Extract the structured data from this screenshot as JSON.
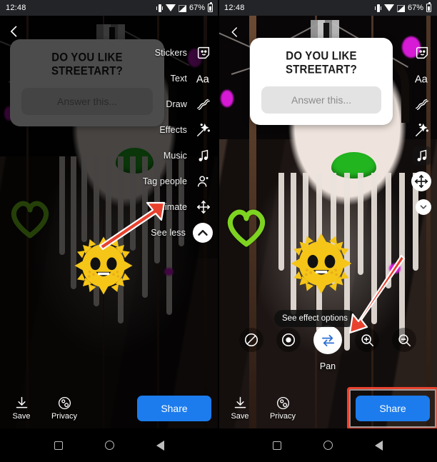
{
  "status_bar": {
    "time": "12:48",
    "battery_percent": "67%",
    "icons": [
      "vibrate-icon",
      "wifi-icon",
      "signal-icon",
      "battery-icon"
    ]
  },
  "question_sticker": {
    "title": "DO YOU LIKE STREETART?",
    "answer_placeholder": "Answer this..."
  },
  "left_panel": {
    "back_icon": "back-arrow-icon",
    "tool_rail": [
      {
        "label": "Stickers",
        "icon": "sticker-face-icon"
      },
      {
        "label": "Text",
        "icon": "text-aa-icon"
      },
      {
        "label": "Draw",
        "icon": "draw-squiggle-icon"
      },
      {
        "label": "Effects",
        "icon": "effects-sparkle-wand-icon"
      },
      {
        "label": "Music",
        "icon": "music-note-icon"
      },
      {
        "label": "Tag people",
        "icon": "tag-person-icon"
      },
      {
        "label": "Animate",
        "icon": "animate-move-arrows-icon"
      },
      {
        "label": "See less",
        "icon": "chevron-up-icon"
      }
    ],
    "bottom_actions": [
      {
        "label": "Save",
        "icon": "download-save-icon"
      },
      {
        "label": "Privacy",
        "icon": "privacy-gear-icon"
      }
    ],
    "share_label": "Share",
    "annotation": "red-arrow-pointing-to-animate"
  },
  "right_panel": {
    "back_icon": "back-chevron-icon",
    "tool_rail": [
      {
        "label": "Stickers",
        "icon": "sticker-face-icon"
      },
      {
        "label": "Text",
        "icon": "text-aa-icon"
      },
      {
        "label": "Draw",
        "icon": "draw-squiggle-icon"
      },
      {
        "label": "Effects",
        "icon": "effects-sparkle-wand-icon"
      },
      {
        "label": "Music",
        "icon": "music-note-icon"
      },
      {
        "label": "Animate",
        "icon": "animate-move-arrows-icon"
      },
      {
        "label": "See less",
        "icon": "chevron-down-icon"
      }
    ],
    "effect_tooltip": "See effect options",
    "effect_options": [
      {
        "name": "none",
        "icon": "no-effect-slash-icon",
        "selected": false
      },
      {
        "name": "focus",
        "icon": "focus-dot-icon",
        "selected": false
      },
      {
        "name": "pan",
        "icon": "pan-arrows-icon",
        "selected": true
      },
      {
        "name": "zoom-in",
        "icon": "magnifier-plus-icon",
        "selected": false
      },
      {
        "name": "zoom-out",
        "icon": "magnifier-minus-icon",
        "selected": false
      }
    ],
    "effect_selected_label": "Pan",
    "bottom_actions": [
      {
        "label": "Save",
        "icon": "download-save-icon"
      },
      {
        "label": "Privacy",
        "icon": "privacy-gear-icon"
      }
    ],
    "share_label": "Share",
    "annotation": "red-arrow-pointing-to-pan-button",
    "highlight": "red-box-around-share-button"
  },
  "nav_bar": {
    "buttons": [
      {
        "name": "recents",
        "icon": "square-icon"
      },
      {
        "name": "home",
        "icon": "circle-icon"
      },
      {
        "name": "back",
        "icon": "triangle-back-icon"
      }
    ]
  },
  "colors": {
    "accent_blue": "#1c7ced",
    "annotation_red": "#e8422f",
    "graffiti_green": "#22b520",
    "sun_yellow": "#f5c518"
  }
}
